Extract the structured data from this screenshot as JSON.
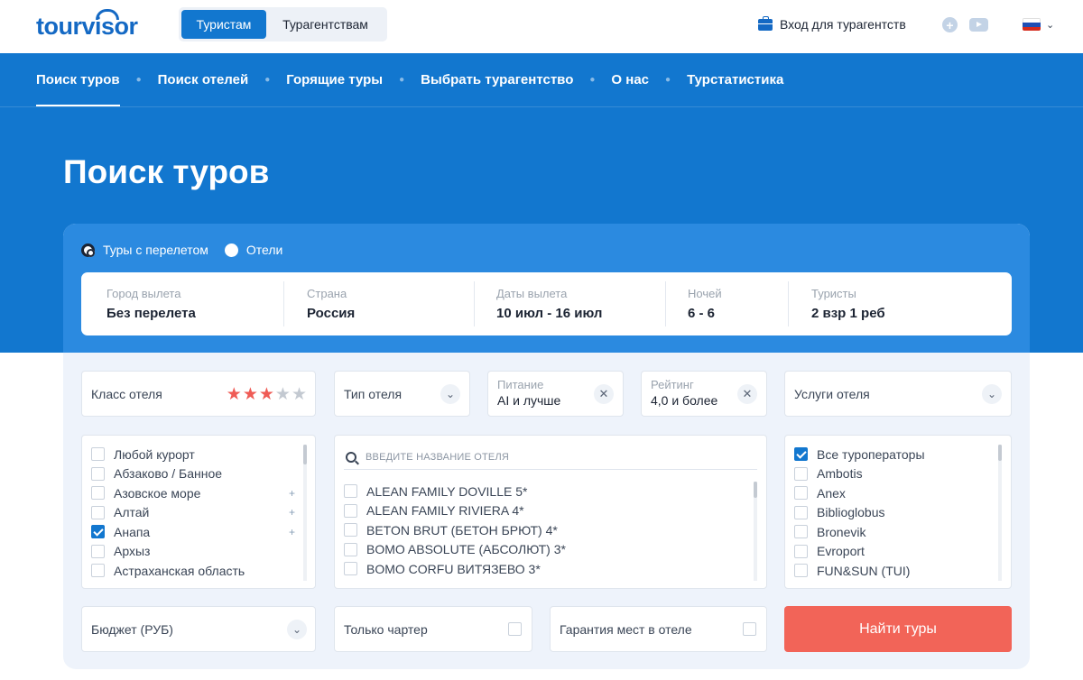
{
  "header": {
    "logo": "tourvisor",
    "segments": [
      "Туристам",
      "Турагентствам"
    ],
    "agent_login": "Вход для турагентств",
    "icons": [
      "briefcase-icon",
      "plus-circle-icon",
      "youtube-icon",
      "russia-flag-icon",
      "chevron-down-icon"
    ]
  },
  "nav": [
    "Поиск туров",
    "Поиск отелей",
    "Горящие туры",
    "Выбрать турагентство",
    "О нас",
    "Турстатистика"
  ],
  "page_title": "Поиск туров",
  "search": {
    "mode_options": [
      "Туры с перелетом",
      "Отели"
    ],
    "fields": [
      {
        "label": "Город вылета",
        "value": "Без перелета"
      },
      {
        "label": "Страна",
        "value": "Россия"
      },
      {
        "label": "Даты вылета",
        "value": "10 июл - 16 июл"
      },
      {
        "label": "Ночей",
        "value": "6 - 6"
      },
      {
        "label": "Туристы",
        "value": "2 взр 1 реб"
      }
    ]
  },
  "filters": {
    "hotel_class": {
      "label": "Класс отеля",
      "stars_selected": 3,
      "stars_total": 5
    },
    "hotel_type": {
      "label": "Тип отеля"
    },
    "meal": {
      "label": "Питание",
      "value": "AI и лучше"
    },
    "rating": {
      "label": "Рейтинг",
      "value": "4,0 и более"
    },
    "services": {
      "label": "Услуги отеля"
    }
  },
  "resorts": [
    {
      "name": "Любой курорт",
      "checked": false,
      "expandable": false
    },
    {
      "name": "Абзаково / Банное",
      "checked": false,
      "expandable": false
    },
    {
      "name": "Азовское море",
      "checked": false,
      "expandable": true
    },
    {
      "name": "Алтай",
      "checked": false,
      "expandable": true
    },
    {
      "name": "Анапа",
      "checked": true,
      "expandable": true
    },
    {
      "name": "Архыз",
      "checked": false,
      "expandable": false
    },
    {
      "name": "Астраханская область",
      "checked": false,
      "expandable": false
    }
  ],
  "hotels": {
    "placeholder": "Введите название отеля",
    "items": [
      "ALEAN FAMILY DOVILLE 5*",
      "ALEAN FAMILY RIVIERA 4*",
      "BETON BRUT (БЕТОН БРЮТ) 4*",
      "BOMO ABSOLUTE (АБСОЛЮТ) 3*",
      "BOMO CORFU ВИТЯЗЕВО 3*"
    ]
  },
  "operators": [
    {
      "name": "Все туроператоры",
      "checked": true
    },
    {
      "name": "Ambotis",
      "checked": false
    },
    {
      "name": "Anex",
      "checked": false
    },
    {
      "name": "Biblioglobus",
      "checked": false
    },
    {
      "name": "Bronevik",
      "checked": false
    },
    {
      "name": "Evroport",
      "checked": false
    },
    {
      "name": "FUN&SUN (TUI)",
      "checked": false
    }
  ],
  "bottom": {
    "budget": "Бюджет (РУБ)",
    "charter": "Только чартер",
    "guarantee": "Гарантия мест в отеле",
    "find": "Найти туры"
  },
  "colors": {
    "brand": "#1277cf",
    "accent": "#f26458",
    "star_on": "#ef5b55"
  }
}
